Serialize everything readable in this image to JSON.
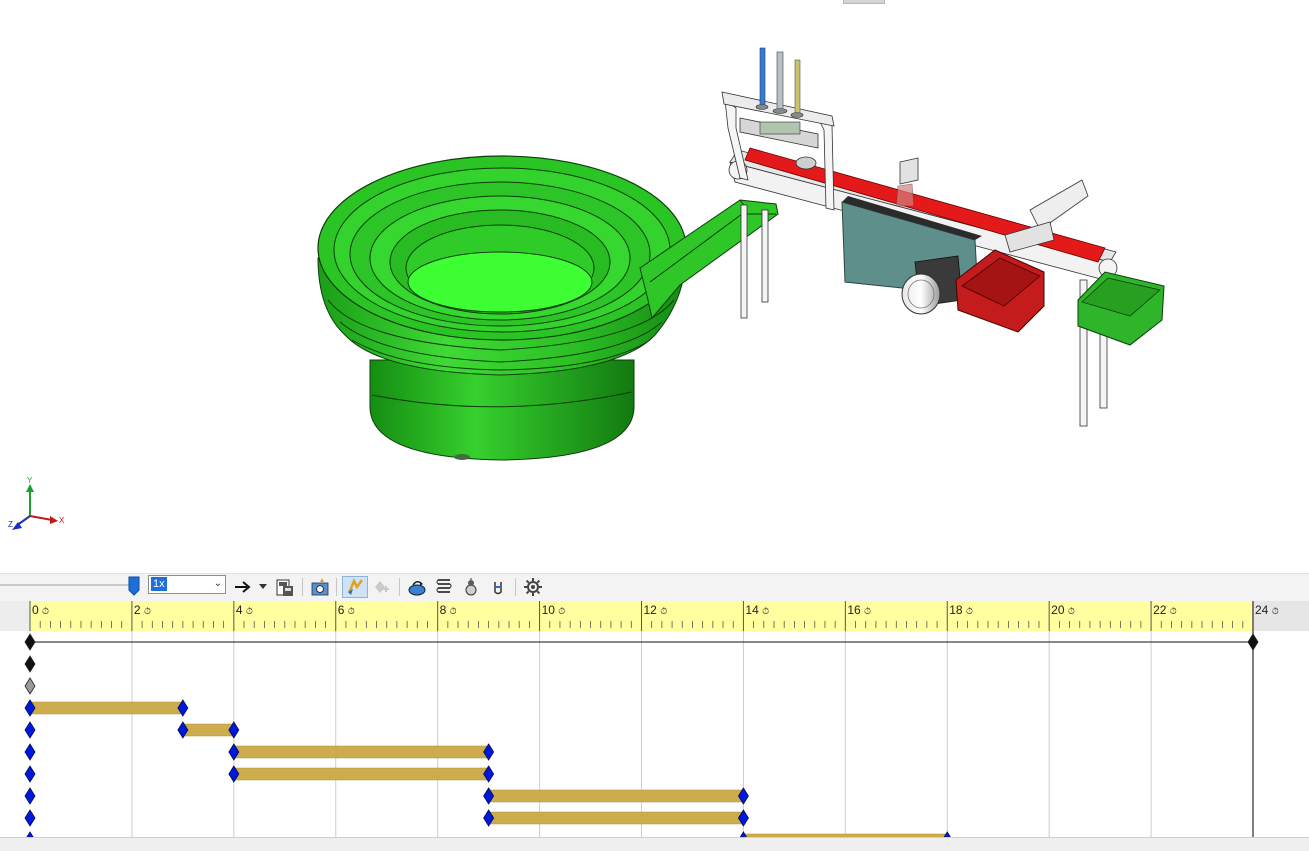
{
  "toolbar": {
    "speed_value": "1x",
    "icons": [
      "playback-slider",
      "speed-dropdown",
      "play-mode-arrow",
      "play-mode-dropdown",
      "save-animation",
      "animation-wizard",
      "autokey",
      "add-update-key",
      "motors",
      "spring",
      "contact",
      "gravity",
      "motion-study-properties"
    ]
  },
  "timeline": {
    "tick_labels": [
      "0",
      "2",
      "4",
      "6",
      "8",
      "10",
      "12",
      "14",
      "16",
      "18",
      "20",
      "22",
      "24"
    ],
    "rows": [
      {
        "keys": [
          0,
          24
        ],
        "bar": null,
        "color": "black"
      },
      {
        "keys": [
          0
        ],
        "bar": null,
        "color": "black"
      },
      {
        "keys": [
          0
        ],
        "bar": null,
        "color": "gray"
      },
      {
        "keys": [
          0,
          3
        ],
        "bar": [
          0,
          3
        ],
        "color": "blue"
      },
      {
        "keys": [
          0,
          3,
          4
        ],
        "bar": [
          3,
          4
        ],
        "color": "blue"
      },
      {
        "keys": [
          0,
          4,
          9
        ],
        "bar": [
          4,
          9
        ],
        "color": "blue"
      },
      {
        "keys": [
          0,
          4,
          9
        ],
        "bar": [
          4,
          9
        ],
        "color": "blue"
      },
      {
        "keys": [
          0,
          9,
          14
        ],
        "bar": [
          9,
          14
        ],
        "color": "blue"
      },
      {
        "keys": [
          0,
          9,
          14
        ],
        "bar": [
          9,
          14
        ],
        "color": "blue"
      },
      {
        "keys": [
          0,
          14,
          18
        ],
        "bar": [
          14,
          18
        ],
        "color": "blue"
      }
    ]
  },
  "triad": {
    "x": "X",
    "y": "Y",
    "z": "Z"
  },
  "colors": {
    "bowl_green": "#22c31c",
    "bowl_light": "#3aff30",
    "belt_red": "#e41a1a",
    "bin_red": "#c41c1c",
    "bin_green": "#2fb52a",
    "ruler_yellow": "#ffff9f",
    "bar_gold": "#ccac4c",
    "key_blue": "#0018d8"
  }
}
